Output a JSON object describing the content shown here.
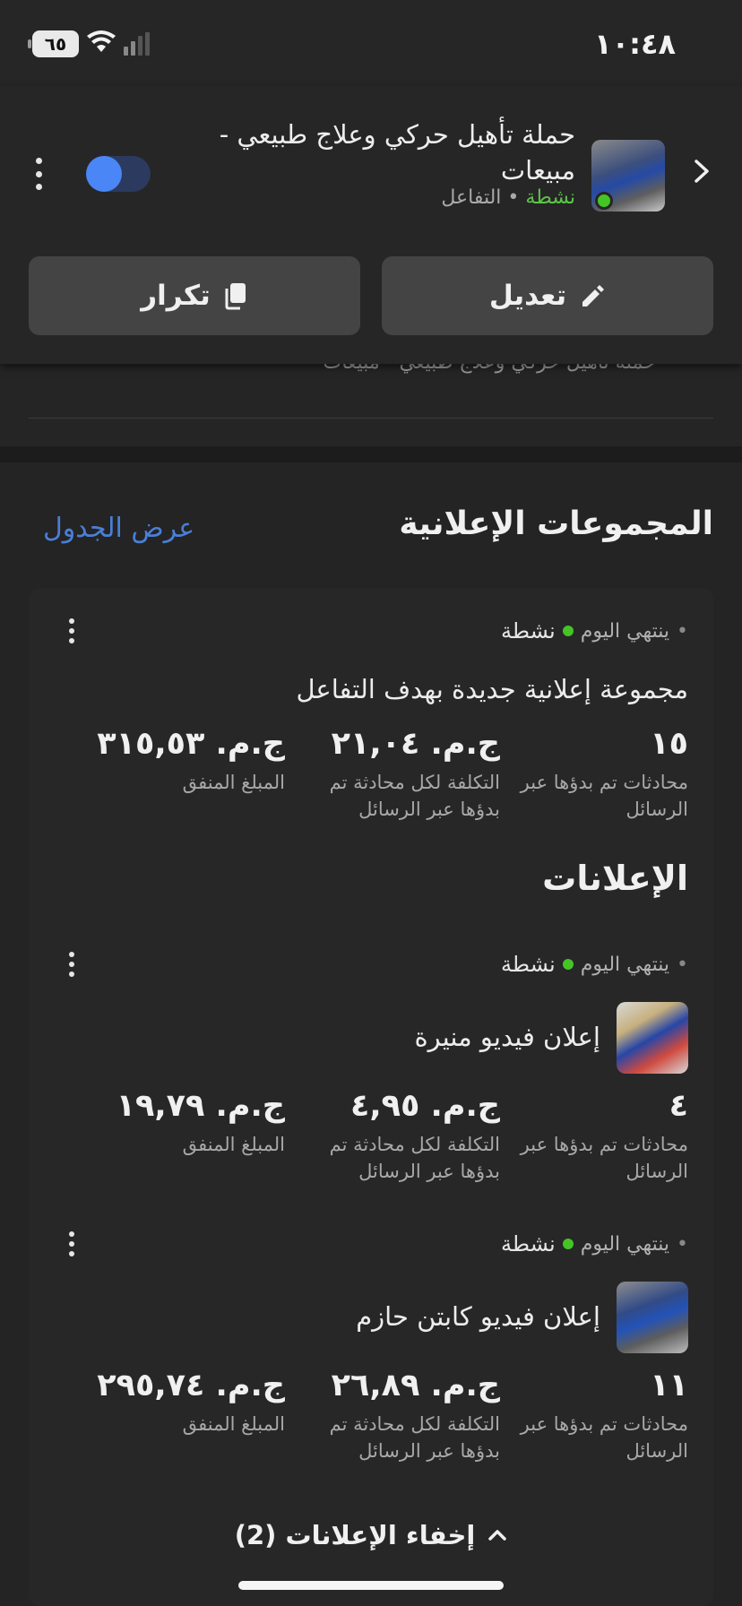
{
  "status_bar": {
    "time": "١٠:٤٨",
    "battery": "٦٥"
  },
  "campaign": {
    "title": "حملة تأهيل حركي وعلاج طبيعي - مبيعات",
    "status": "نشطة",
    "objective": "التفاعل",
    "toggle_on": true,
    "edit_label": "تعديل",
    "duplicate_label": "تكرار",
    "partial_line": "حملة تأهيل حركي وعلاج طبيعي - مبيعات"
  },
  "ad_sets_section": {
    "title": "المجموعات الإعلانية",
    "view_table_link": "عرض الجدول"
  },
  "ad_set": {
    "schedule": "ينتهي اليوم",
    "status": "نشطة",
    "name": "مجموعة إعلانية جديدة بهدف التفاعل",
    "metrics": [
      {
        "value": "١٥",
        "label": "محادثات تم بدؤها عبر الرسائل"
      },
      {
        "value": "ج.م. ٢١,٠٤",
        "label": "التكلفة لكل محادثة تم بدؤها عبر الرسائل"
      },
      {
        "value": "ج.م. ٣١٥,٥٣",
        "label": "المبلغ المنفق"
      }
    ]
  },
  "ads_section": {
    "title": "الإعلانات",
    "hide_label": "إخفاء الإعلانات (2)"
  },
  "ads": [
    {
      "schedule": "ينتهي اليوم",
      "status": "نشطة",
      "name": "إعلان فيديو منيرة",
      "metrics": [
        {
          "value": "٤",
          "label": "محادثات تم بدؤها عبر الرسائل"
        },
        {
          "value": "ج.م. ٤,٩٥",
          "label": "التكلفة لكل محادثة تم بدؤها عبر الرسائل"
        },
        {
          "value": "ج.م. ١٩,٧٩",
          "label": "المبلغ المنفق"
        }
      ]
    },
    {
      "schedule": "ينتهي اليوم",
      "status": "نشطة",
      "name": "إعلان فيديو كابتن حازم",
      "metrics": [
        {
          "value": "١١",
          "label": "محادثات تم بدؤها عبر الرسائل"
        },
        {
          "value": "ج.م. ٢٦,٨٩",
          "label": "التكلفة لكل محادثة تم بدؤها عبر الرسائل"
        },
        {
          "value": "ج.م. ٢٩٥,٧٤",
          "label": "المبلغ المنفق"
        }
      ]
    }
  ],
  "colors": {
    "active_green": "#45c426",
    "link_blue": "#4a7fd8",
    "toggle_blue": "#4a86f5",
    "background": "#252525"
  },
  "icons": [
    "battery-icon",
    "wifi-icon",
    "signal-icon",
    "chevron-right-icon",
    "more-icon",
    "pencil-icon",
    "copy-icon",
    "chevron-up-icon"
  ]
}
